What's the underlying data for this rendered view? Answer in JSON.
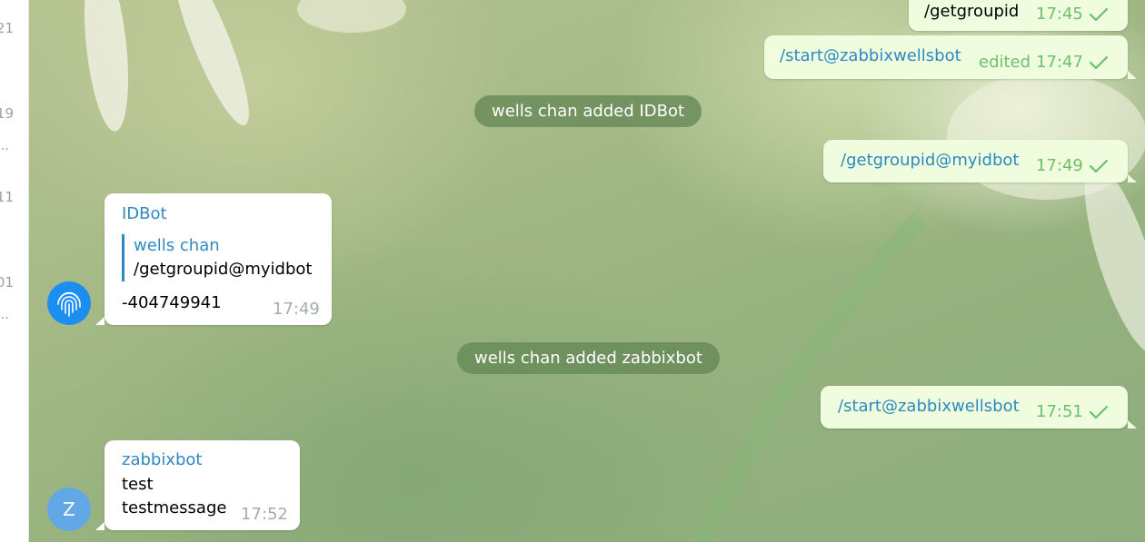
{
  "sidebar": {
    "fragments": [
      "21",
      "19",
      "...",
      "11",
      "01",
      "..."
    ]
  },
  "service_messages": [
    {
      "text": "wells chan added IDBot"
    },
    {
      "text": "wells chan added zabbixbot"
    }
  ],
  "outgoing": [
    {
      "text": "/getgroupid",
      "time": "17:45",
      "edited": "",
      "status_icon": "check-icon"
    },
    {
      "text": "/start@zabbixwellsbot",
      "time": "17:47",
      "edited": "edited",
      "status_icon": "check-icon"
    },
    {
      "text": "/getgroupid@myidbot",
      "time": "17:49",
      "edited": "",
      "status_icon": "check-icon"
    },
    {
      "text": "/start@zabbixwellsbot",
      "time": "17:51",
      "edited": "",
      "status_icon": "check-icon"
    }
  ],
  "incoming": [
    {
      "sender": "IDBot",
      "avatar_icon": "fingerprint-icon",
      "reply": {
        "name": "wells chan",
        "text": "/getgroupid@myidbot"
      },
      "lines": [
        "-404749941"
      ],
      "time": "17:49"
    },
    {
      "sender": "zabbixbot",
      "avatar_letter": "Z",
      "lines": [
        "test",
        "testmessage"
      ],
      "time": "17:52"
    }
  ],
  "colors": {
    "outgoing_bubble": "#effdde",
    "incoming_bubble": "#ffffff",
    "link": "#2e89c2",
    "read_check": "#6dbf6d",
    "service_pill": "#688a58"
  }
}
